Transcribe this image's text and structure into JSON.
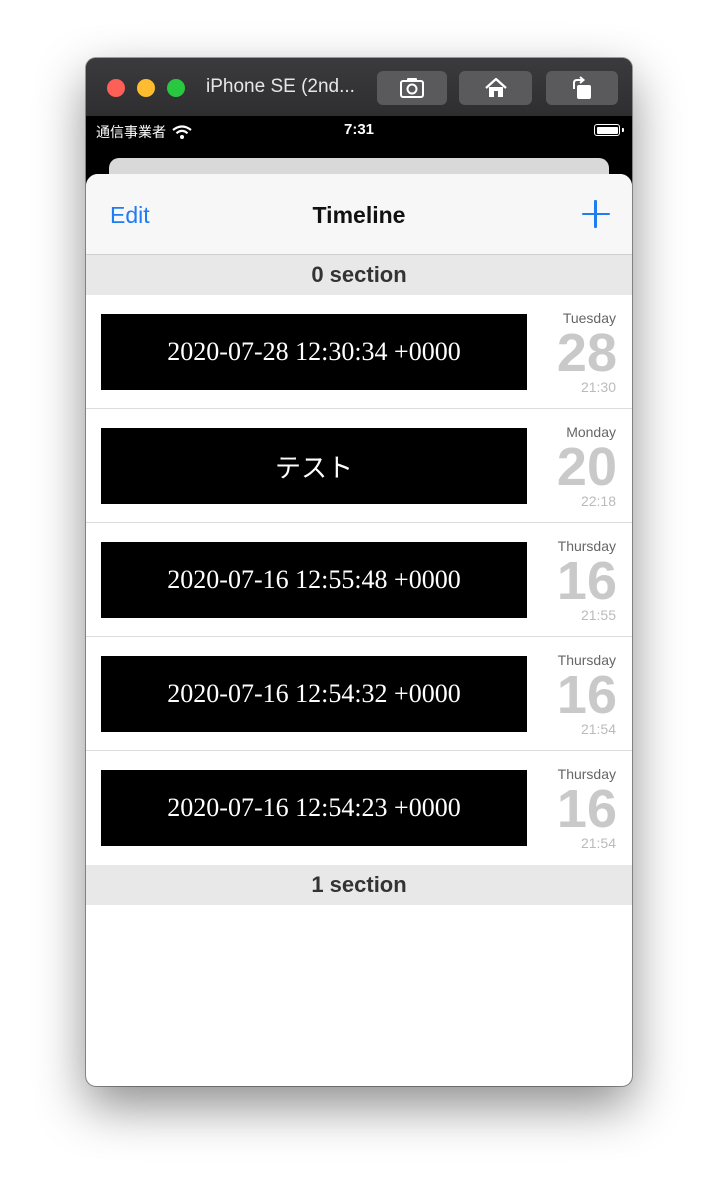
{
  "window": {
    "title": "iPhone SE (2nd...",
    "buttons": [
      "screenshot-icon",
      "home-icon",
      "rotate-icon"
    ]
  },
  "statusbar": {
    "carrier": "通信事業者",
    "time": "7:31"
  },
  "navbar": {
    "edit_label": "Edit",
    "title": "Timeline"
  },
  "sections": [
    {
      "header": "0 section",
      "rows": [
        {
          "text": "2020-07-28 12:30:34 +0000",
          "weekday": "Tuesday",
          "day": "28",
          "time": "21:30"
        },
        {
          "text": "テスト",
          "weekday": "Monday",
          "day": "20",
          "time": "22:18"
        },
        {
          "text": "2020-07-16 12:55:48 +0000",
          "weekday": "Thursday",
          "day": "16",
          "time": "21:55"
        },
        {
          "text": "2020-07-16 12:54:32 +0000",
          "weekday": "Thursday",
          "day": "16",
          "time": "21:54"
        },
        {
          "text": "2020-07-16 12:54:23 +0000",
          "weekday": "Thursday",
          "day": "16",
          "time": "21:54"
        }
      ]
    },
    {
      "header": "1 section",
      "rows": []
    }
  ],
  "colors": {
    "accent": "#1f7cf2",
    "card_background": "#000000",
    "section_header": "#e8e8e8"
  }
}
